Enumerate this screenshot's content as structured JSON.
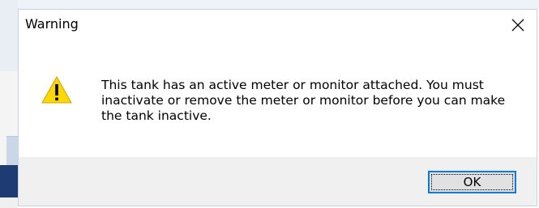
{
  "dialog": {
    "title": "Warning",
    "close_icon": "close-icon",
    "warning_icon": "warning-icon",
    "message": "This tank has an active meter or monitor attached. You must inactivate or remove the meter or monitor before you can make the tank inactive.",
    "ok_label": "OK"
  },
  "colors": {
    "accent": "#0078d7",
    "warning_yellow": "#ffd800",
    "footer_bg": "#f0f0f0"
  }
}
